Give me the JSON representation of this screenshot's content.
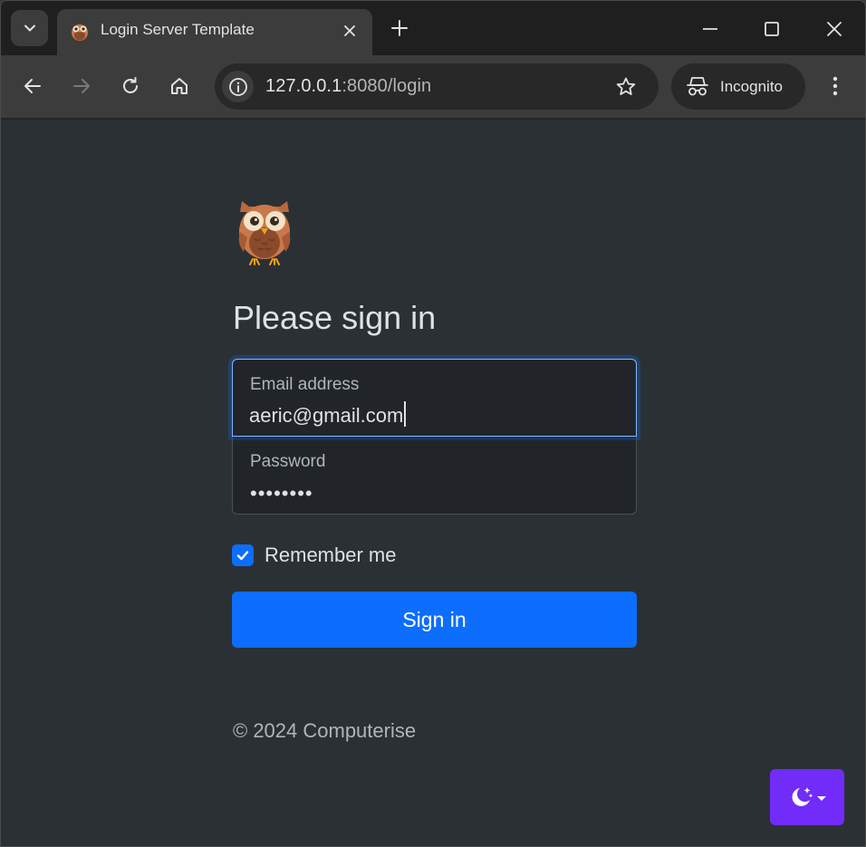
{
  "browser": {
    "tab": {
      "title": "Login Server Template",
      "favicon": "owl-icon"
    },
    "url": {
      "host": "127.0.0.1",
      "path": ":8080/login"
    },
    "incognito_label": "Incognito",
    "icons": [
      "tab-search-icon",
      "close-icon",
      "plus-icon",
      "minimize-icon",
      "maximize-icon",
      "back-arrow-icon",
      "forward-arrow-icon",
      "reload-icon",
      "home-icon",
      "site-info-icon",
      "star-icon",
      "incognito-icon",
      "kebab-menu-icon"
    ]
  },
  "page": {
    "logo": "owl-icon",
    "heading": "Please sign in",
    "email": {
      "label": "Email address",
      "value": "aeric@gmail.com"
    },
    "password": {
      "label": "Password",
      "masked": "••••••••"
    },
    "remember": {
      "label": "Remember me",
      "checked": true
    },
    "submit_label": "Sign in",
    "footer": "© 2024 Computerise",
    "theme_toggle_icon": "moon-stars-icon"
  },
  "colors": {
    "page_bg": "#2b3035",
    "primary": "#0d6efd",
    "theme_button": "#712cf9"
  }
}
